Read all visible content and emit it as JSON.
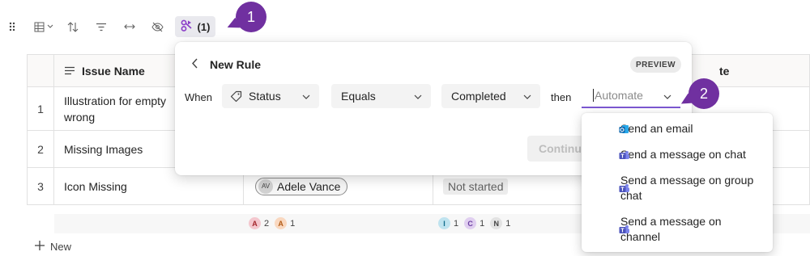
{
  "toolbar": {
    "active_count": "(1)"
  },
  "callouts": [
    "1",
    "2"
  ],
  "table": {
    "header": {
      "issue_name": "Issue Name",
      "last_col_fragment": "te"
    },
    "rows": [
      {
        "num": "1",
        "name": "Illustration for empty wrong",
        "assignee": "",
        "status": ""
      },
      {
        "num": "2",
        "name": "Missing Images",
        "assignee": "",
        "status": ""
      },
      {
        "num": "3",
        "name": "Icon Missing",
        "assignee_initials": "AV",
        "assignee": "Adele Vance",
        "status": "Not started"
      }
    ],
    "summary": {
      "assignees": [
        {
          "letter": "A",
          "count": "2",
          "color": "#f4c7ce"
        },
        {
          "letter": "A",
          "count": "1",
          "color": "#f9d8c0"
        }
      ],
      "statuses": [
        {
          "letter": "I",
          "count": "1",
          "color": "#bfe3ef"
        },
        {
          "letter": "C",
          "count": "1",
          "color": "#e0cff0"
        },
        {
          "letter": "N",
          "count": "1",
          "color": "#e3e3e3"
        }
      ]
    },
    "new_label": "New"
  },
  "rule": {
    "title": "New Rule",
    "badge": "PREVIEW",
    "when_label": "When",
    "field": "Status",
    "operator": "Equals",
    "value": "Completed",
    "then_label": "then",
    "action_placeholder": "Automate",
    "continue_label": "Continue"
  },
  "automate_menu": {
    "items": [
      {
        "label": "Send an email",
        "icon": "outlook-icon"
      },
      {
        "label": "Send a message on chat",
        "icon": "teams-icon"
      },
      {
        "label": "Send a message on group chat",
        "icon": "teams-icon"
      },
      {
        "label": "Send a message on channel",
        "icon": "teams-icon"
      }
    ]
  },
  "colors": {
    "accent": "#7b57d1",
    "callout": "#7030a0",
    "rule_icon": "#8b3ec8"
  }
}
